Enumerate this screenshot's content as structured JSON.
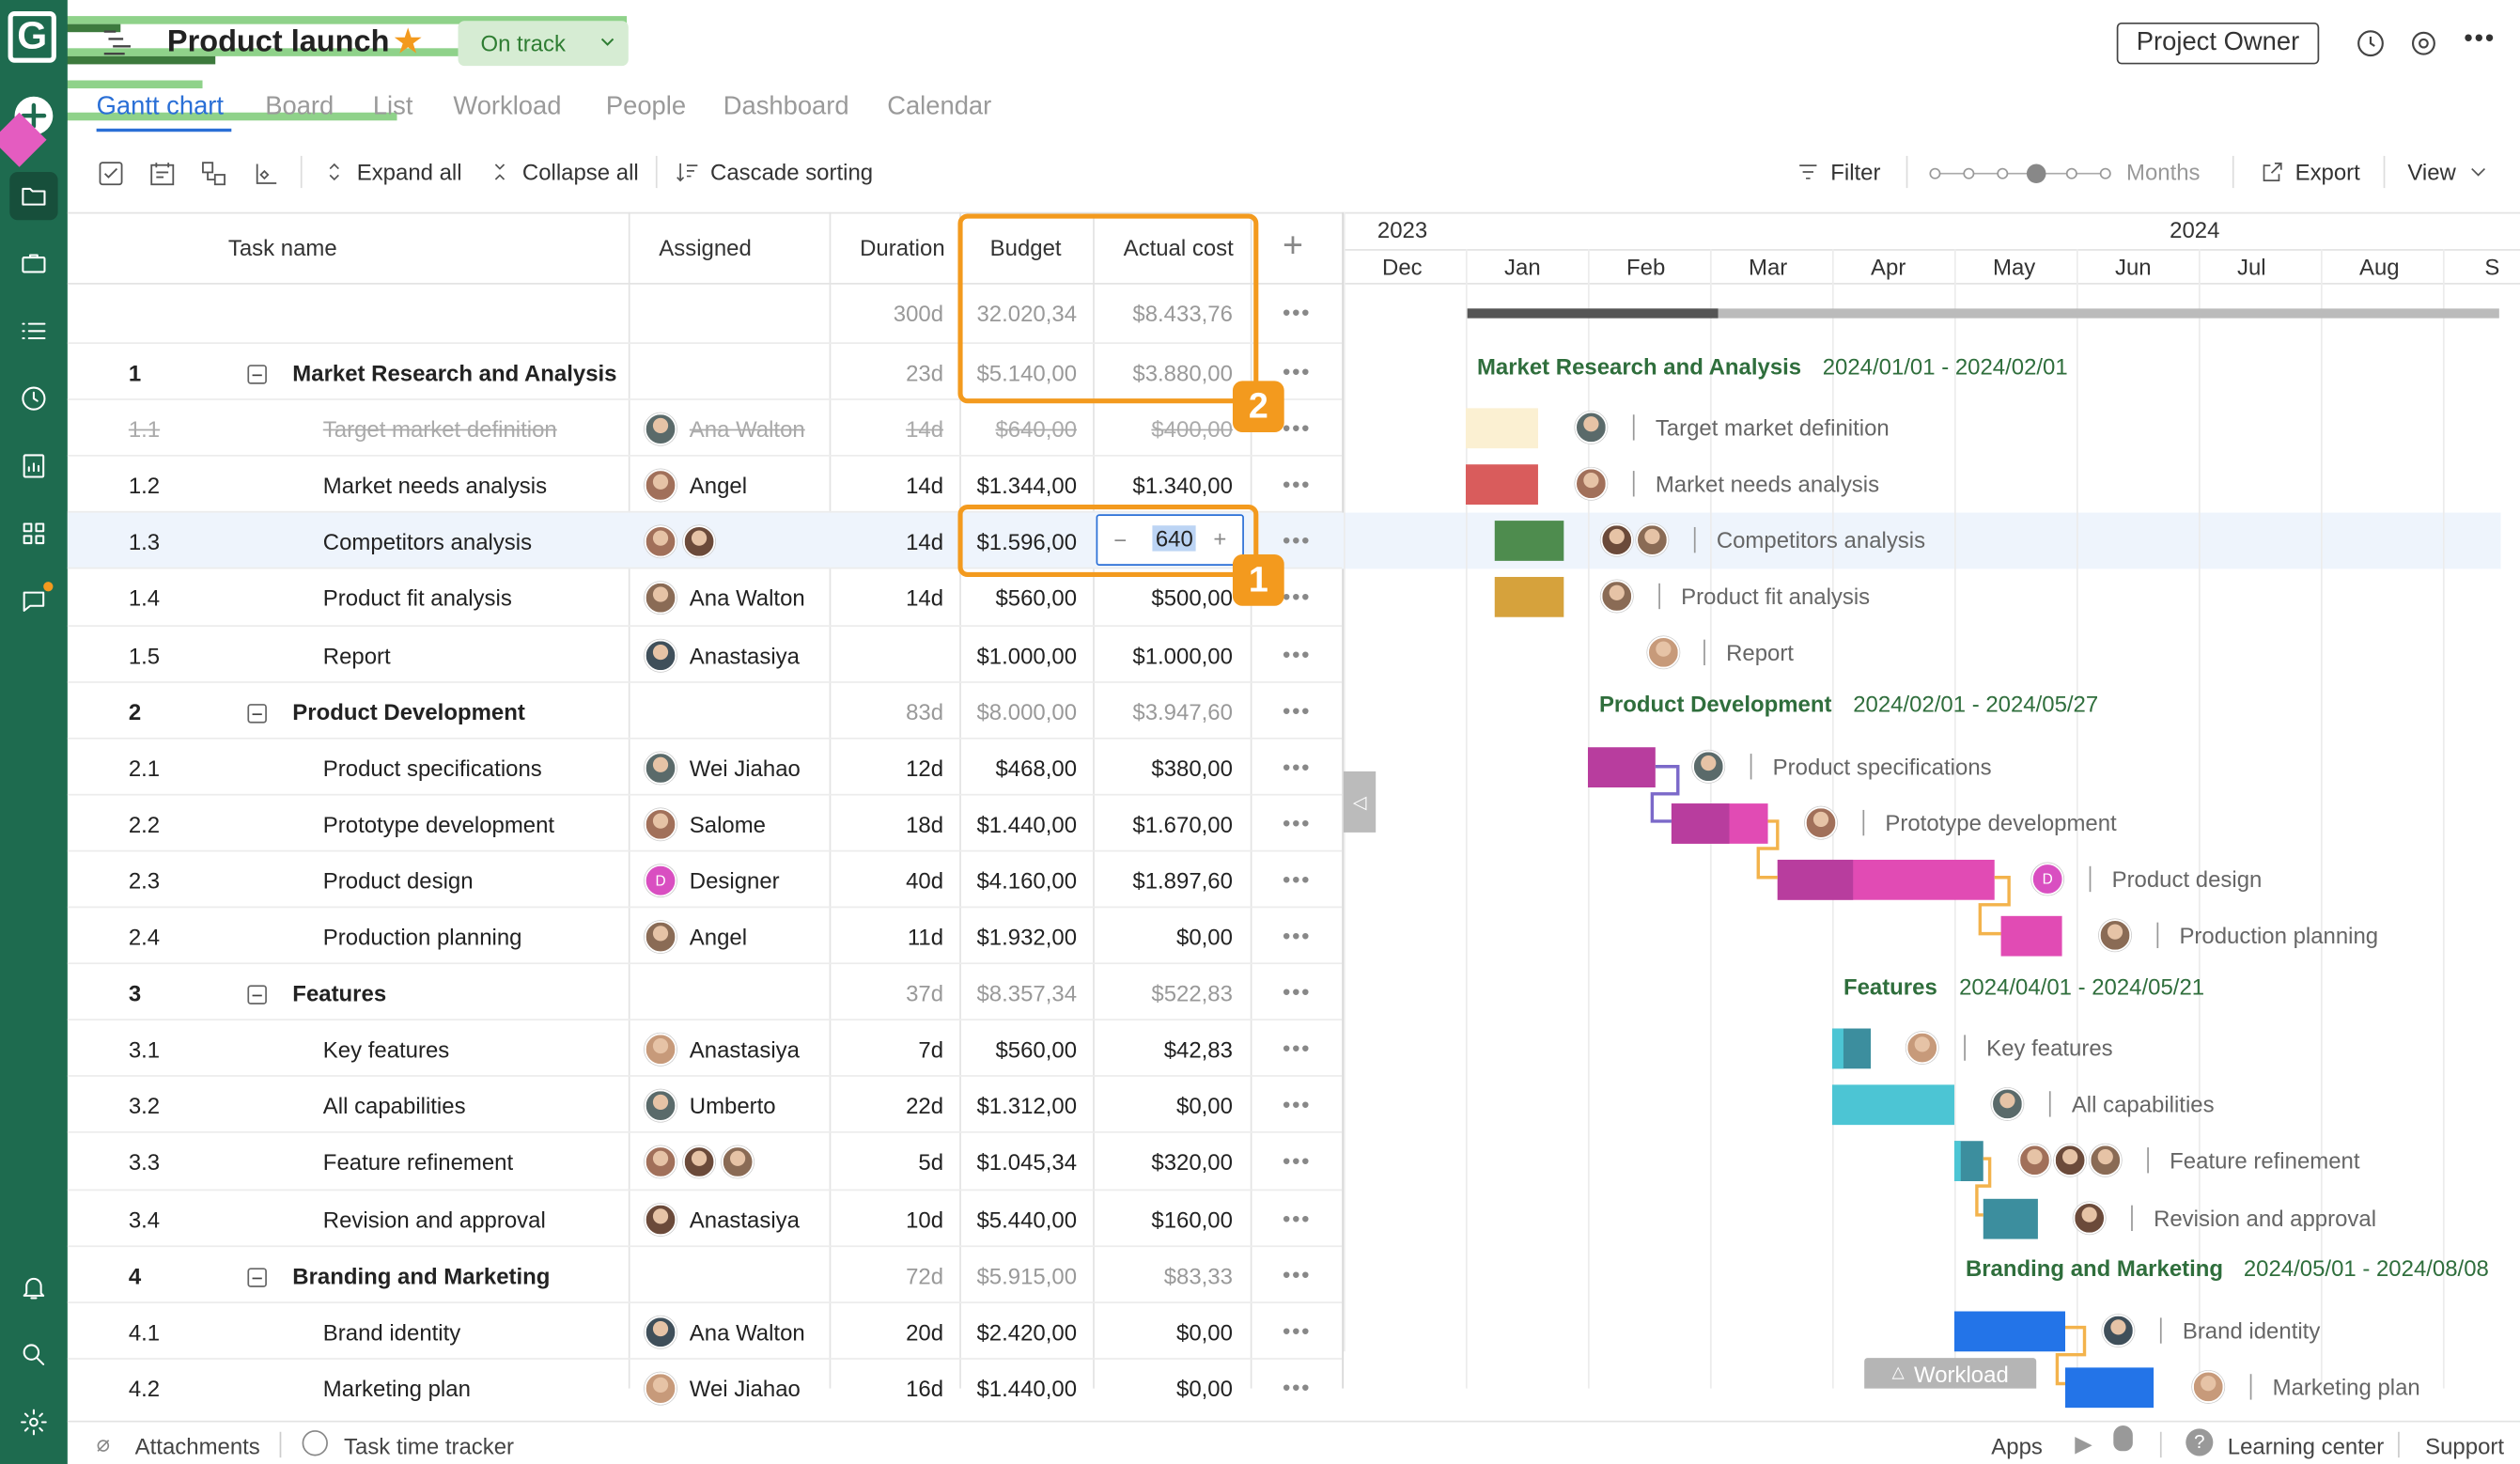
{
  "app": {
    "logo_letter": "G",
    "project_title": "Product launch",
    "status": "On track",
    "owner_button": "Project Owner"
  },
  "tabs": [
    "Gantt chart",
    "Board",
    "List",
    "Workload",
    "People",
    "Dashboard",
    "Calendar"
  ],
  "toolbar": {
    "expand_all": "Expand all",
    "collapse_all": "Collapse all",
    "cascade_sorting": "Cascade sorting",
    "filter": "Filter",
    "zoom_label": "Months",
    "export": "Export",
    "view": "View"
  },
  "grid": {
    "headers": {
      "task_name": "Task name",
      "assigned": "Assigned",
      "duration": "Duration",
      "budget": "Budget",
      "actual_cost": "Actual cost",
      "add": "+"
    },
    "summary": {
      "duration": "300d",
      "budget": "32.020,34",
      "actual": "$8.433,76"
    },
    "rows": [
      {
        "id": "1",
        "name": "Market Research and Analysis",
        "group": true,
        "assigned": "",
        "duration": "23d",
        "budget": "$5.140,00",
        "actual": "$3.880,00"
      },
      {
        "id": "1.1",
        "name": "Target market definition",
        "done": true,
        "assigned": "Ana Walton",
        "duration": "14d",
        "budget": "$640,00",
        "actual": "$400,00"
      },
      {
        "id": "1.2",
        "name": "Market needs analysis",
        "assigned": "Angel",
        "duration": "14d",
        "budget": "$1.344,00",
        "actual": "$1.340,00"
      },
      {
        "id": "1.3",
        "name": "Competitors analysis",
        "assigned": "",
        "duration": "14d",
        "budget": "$1.596,00",
        "actual": "",
        "selected": true
      },
      {
        "id": "1.4",
        "name": "Product fit analysis",
        "assigned": "Ana Walton",
        "duration": "14d",
        "budget": "$560,00",
        "actual": "$500,00"
      },
      {
        "id": "1.5",
        "name": "Report",
        "assigned": "Anastasiya",
        "duration": "",
        "budget": "$1.000,00",
        "actual": "$1.000,00"
      },
      {
        "id": "2",
        "name": "Product Development",
        "group": true,
        "assigned": "",
        "duration": "83d",
        "budget": "$8.000,00",
        "actual": "$3.947,60"
      },
      {
        "id": "2.1",
        "name": "Product specifications",
        "assigned": "Wei Jiahao",
        "duration": "12d",
        "budget": "$468,00",
        "actual": "$380,00"
      },
      {
        "id": "2.2",
        "name": "Prototype development",
        "assigned": "Salome",
        "duration": "18d",
        "budget": "$1.440,00",
        "actual": "$1.670,00"
      },
      {
        "id": "2.3",
        "name": "Product design",
        "assigned": "Designer",
        "duration": "40d",
        "budget": "$4.160,00",
        "actual": "$1.897,60"
      },
      {
        "id": "2.4",
        "name": "Production planning",
        "assigned": "Angel",
        "duration": "11d",
        "budget": "$1.932,00",
        "actual": "$0,00"
      },
      {
        "id": "3",
        "name": "Features",
        "group": true,
        "assigned": "",
        "duration": "37d",
        "budget": "$8.357,34",
        "actual": "$522,83"
      },
      {
        "id": "3.1",
        "name": "Key features",
        "assigned": "Anastasiya",
        "duration": "7d",
        "budget": "$560,00",
        "actual": "$42,83"
      },
      {
        "id": "3.2",
        "name": "All capabilities",
        "assigned": "Umberto",
        "duration": "22d",
        "budget": "$1.312,00",
        "actual": "$0,00"
      },
      {
        "id": "3.3",
        "name": "Feature refinement",
        "assigned": "",
        "duration": "5d",
        "budget": "$1.045,34",
        "actual": "$320,00"
      },
      {
        "id": "3.4",
        "name": "Revision and approval",
        "assigned": "Anastasiya",
        "duration": "10d",
        "budget": "$5.440,00",
        "actual": "$160,00"
      },
      {
        "id": "4",
        "name": "Branding and Marketing",
        "group": true,
        "assigned": "",
        "duration": "72d",
        "budget": "$5.915,00",
        "actual": "$83,33"
      },
      {
        "id": "4.1",
        "name": "Brand identity",
        "assigned": "Ana Walton",
        "duration": "20d",
        "budget": "$2.420,00",
        "actual": "$0,00"
      },
      {
        "id": "4.2",
        "name": "Marketing plan",
        "assigned": "Wei Jiahao",
        "duration": "16d",
        "budget": "$1.440,00",
        "actual": "$0,00"
      }
    ],
    "editor": {
      "minus": "−",
      "value": "640",
      "plus": "+"
    },
    "designer_initial": "D"
  },
  "annotations": {
    "badge1": "1",
    "badge2": "2"
  },
  "gantt": {
    "years": [
      "2023",
      "2024"
    ],
    "months": [
      "Dec",
      "Jan",
      "Feb",
      "Mar",
      "Apr",
      "May",
      "Jun",
      "Jul",
      "Aug",
      "S"
    ],
    "groups": [
      {
        "title": "Market Research and Analysis",
        "dates": "2024/01/01 - 2024/02/01"
      },
      {
        "title": "Product Development",
        "dates": "2024/02/01 - 2024/05/27"
      },
      {
        "title": "Features",
        "dates": "2024/04/01 - 2024/05/21"
      },
      {
        "title": "Branding and Marketing",
        "dates": "2024/05/01 - 2024/08/08"
      }
    ],
    "task_labels": [
      "Target market definition",
      "Market needs analysis",
      "Competitors analysis",
      "Product fit analysis",
      "Report",
      "Product specifications",
      "Prototype development",
      "Product design",
      "Production planning",
      "Key features",
      "All capabilities",
      "Feature refinement",
      "Revision and approval",
      "Brand identity",
      "Marketing plan"
    ],
    "workload_label": "Workload",
    "colors": {
      "green": "#4e8c4e",
      "red": "#d95c5c",
      "mustard": "#d6a23c",
      "pink": "#e14bb4",
      "magenta": "#b83d9e",
      "teal": "#4cc5d4",
      "darkteal": "#3c8e9e",
      "blue": "#2374e8",
      "paleyellow": "#fbf0d2"
    }
  },
  "footer": {
    "attachments": "Attachments",
    "time_tracker": "Task time tracker",
    "apps": "Apps",
    "learning": "Learning center",
    "support": "Support"
  }
}
